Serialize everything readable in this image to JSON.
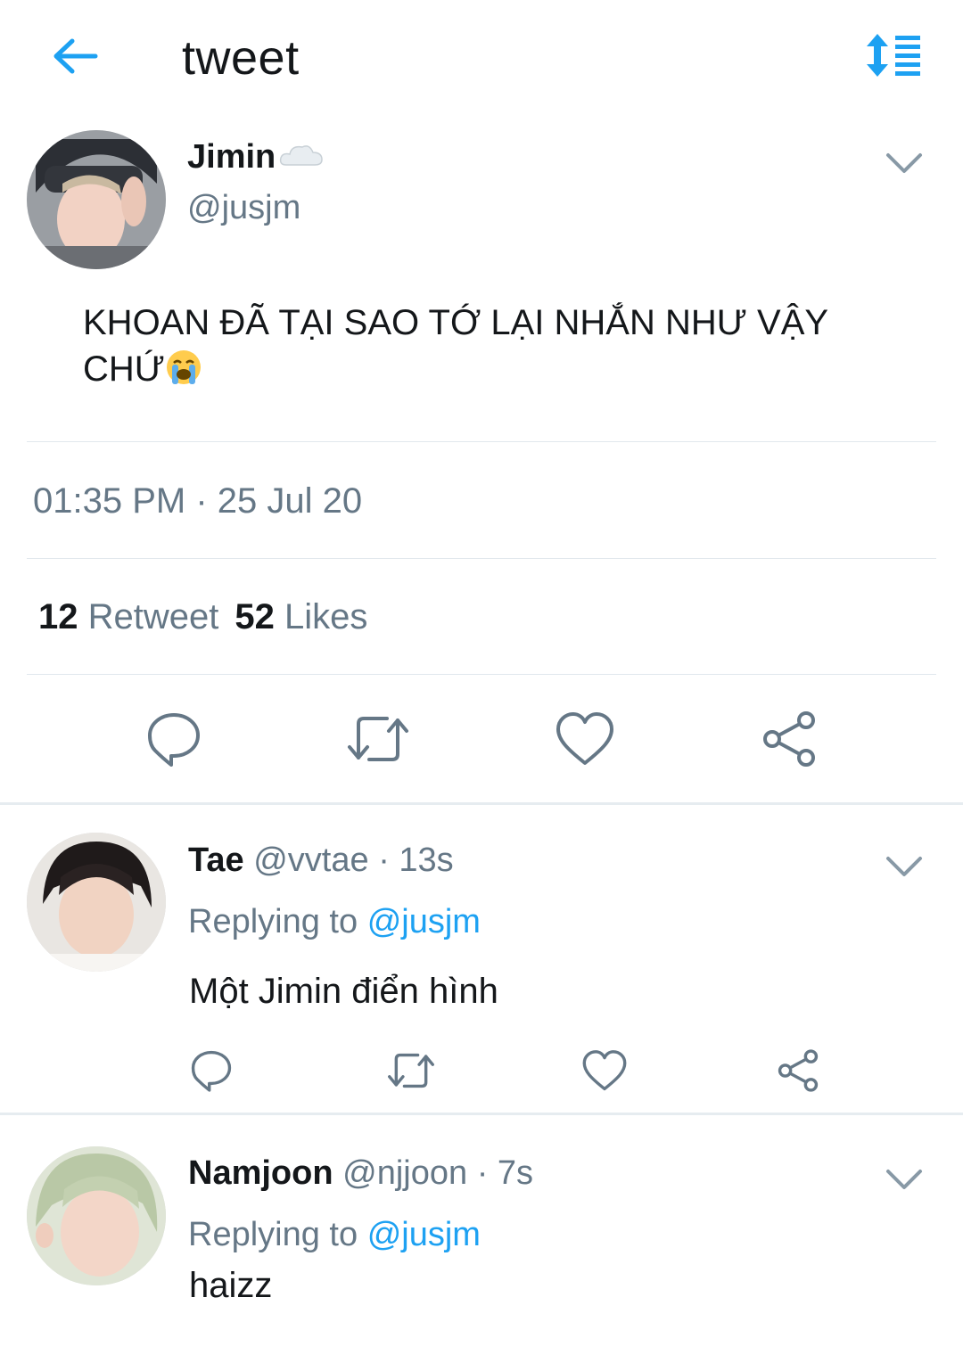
{
  "header": {
    "title": "tweet",
    "back_icon": "arrow-left-icon",
    "sort_icon": "sort-list-icon",
    "accent": "#1da1f2"
  },
  "tweet": {
    "author_name": "Jimin",
    "name_emoji": "cloud-icon",
    "handle": "@jusjm",
    "text": "KHOAN ĐÃ TẠI SAO TỚ LẠI NHẮN NHƯ VẬY CHỨ",
    "text_emoji": "loudly-crying-face-icon",
    "timestamp": "01:35 PM · 25 Jul 20",
    "retweet_count": "12",
    "retweet_label": "Retweet",
    "like_count": "52",
    "like_label": "Likes",
    "actions": [
      "reply-icon",
      "retweet-icon",
      "like-icon",
      "share-icon"
    ]
  },
  "replies": [
    {
      "name": "Tae",
      "handle": "@vvtae",
      "time": "· 13s",
      "replying_prefix": "Replying to",
      "replying_to": "@jusjm",
      "text": "Một Jimin điển hình"
    },
    {
      "name": "Namjoon",
      "handle": "@njjoon",
      "time": "· 7s",
      "replying_prefix": "Replying to",
      "replying_to": "@jusjm",
      "text": "haizz"
    }
  ],
  "colors": {
    "primary_text": "#14171a",
    "secondary_text": "#657786",
    "mention": "#1da1f2",
    "icon": "#657786",
    "divider": "#e1e8ed"
  }
}
